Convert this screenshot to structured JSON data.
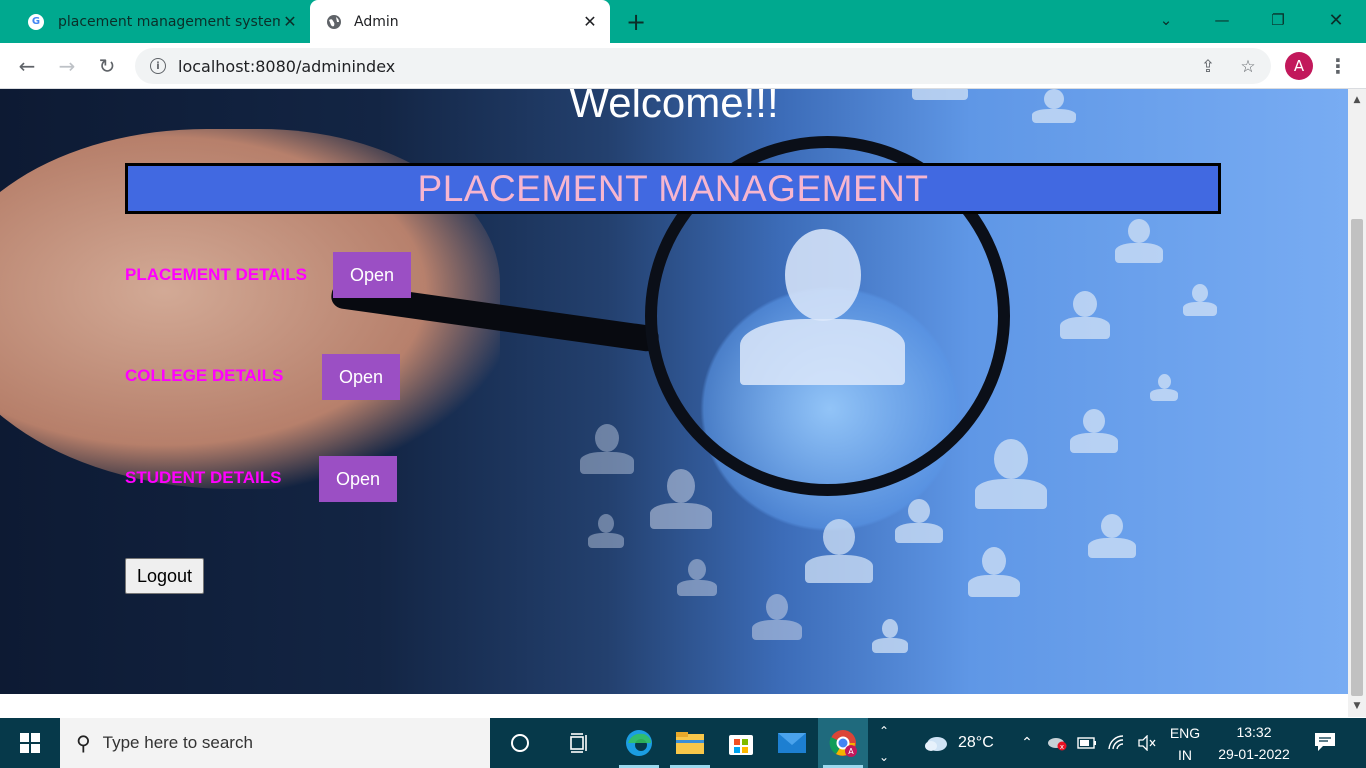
{
  "browser": {
    "tabs": [
      {
        "title": "placement management system",
        "favicon": "google-g-icon",
        "active": false
      },
      {
        "title": "Admin",
        "favicon": "globe-icon",
        "active": true
      }
    ],
    "url_host": "localhost",
    "url_rest": ":8080/adminindex",
    "profile_initial": "A"
  },
  "page": {
    "welcome": "Welcome!!!",
    "banner": "PLACEMENT MANAGEMENT",
    "sections": [
      {
        "label": "PLACEMENT DETAILS",
        "button": "Open"
      },
      {
        "label": "COLLEGE DETAILS",
        "button": "Open"
      },
      {
        "label": "STUDENT DETAILS",
        "button": "Open"
      }
    ],
    "logout": "Logout"
  },
  "taskbar": {
    "search_placeholder": "Type here to search",
    "weather": "28°C",
    "language": "ENG",
    "region": "IN",
    "time": "13:32",
    "date": "29-01-2022"
  },
  "colors": {
    "tab_bar": "#00a98f",
    "banner_bg": "#4169e1",
    "banner_text": "#f7b6cf",
    "section_label": "#ff00ff",
    "open_button": "#9b4fc4",
    "taskbar": "#06394a"
  }
}
